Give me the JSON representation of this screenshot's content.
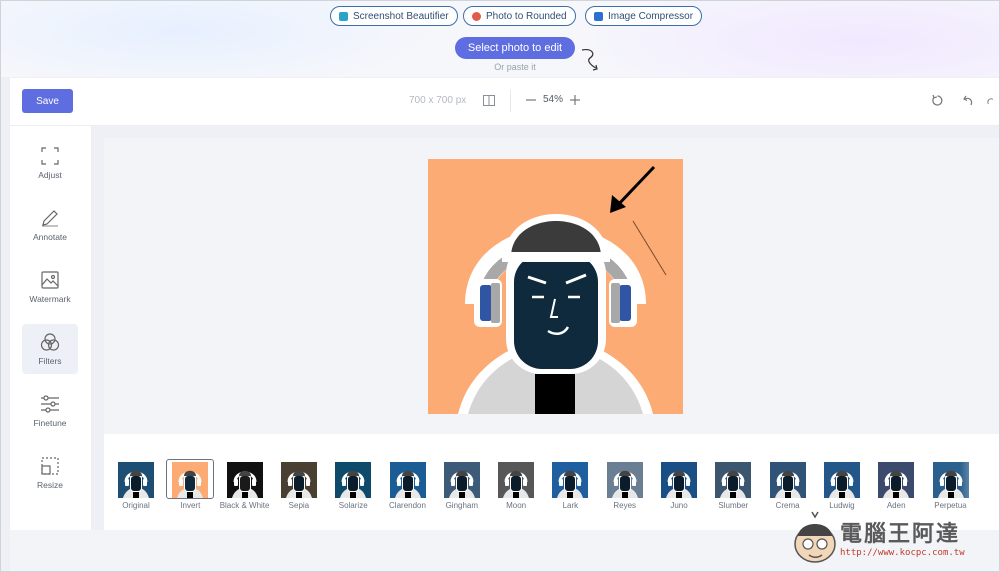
{
  "top_tools": [
    {
      "label": "Screenshot Beautifier",
      "icon": "screenshot-icon",
      "color": "#2aa3c9"
    },
    {
      "label": "Photo to Rounded",
      "icon": "rounded-icon",
      "color": "#e25a4a"
    },
    {
      "label": "Image Compressor",
      "icon": "compress-icon",
      "color": "#2a6fd1"
    }
  ],
  "upload": {
    "button_label": "Select photo to edit",
    "paste_hint": "Or paste it"
  },
  "toolbar": {
    "save_label": "Save",
    "dimensions": "700 x 700 px",
    "zoom": "54%"
  },
  "sidebar": {
    "items": [
      {
        "label": "Adjust",
        "icon": "crop-icon"
      },
      {
        "label": "Annotate",
        "icon": "pencil-icon"
      },
      {
        "label": "Watermark",
        "icon": "image-icon"
      },
      {
        "label": "Filters",
        "icon": "filters-icon",
        "active": true
      },
      {
        "label": "Finetune",
        "icon": "sliders-icon"
      },
      {
        "label": "Resize",
        "icon": "resize-icon"
      }
    ]
  },
  "filters": {
    "selected": "Invert",
    "items": [
      {
        "label": "Original",
        "bg": "#1d4e73"
      },
      {
        "label": "Invert",
        "bg": "#fbab73"
      },
      {
        "label": "Black & White",
        "bg": "#111111"
      },
      {
        "label": "Sepia",
        "bg": "#4a4032"
      },
      {
        "label": "Solarize",
        "bg": "#0e4b6b"
      },
      {
        "label": "Clarendon",
        "bg": "#1a5c93"
      },
      {
        "label": "Gingham",
        "bg": "#3d5a78"
      },
      {
        "label": "Moon",
        "bg": "#575757"
      },
      {
        "label": "Lark",
        "bg": "#1f5fa0"
      },
      {
        "label": "Reyes",
        "bg": "#6a7f94"
      },
      {
        "label": "Juno",
        "bg": "#1a4f86"
      },
      {
        "label": "Slumber",
        "bg": "#3c566f"
      },
      {
        "label": "Crema",
        "bg": "#2f5477"
      },
      {
        "label": "Ludwig",
        "bg": "#245789"
      },
      {
        "label": "Aden",
        "bg": "#3c4a6e"
      },
      {
        "label": "Perpetua",
        "bg": "#2b5f8d"
      }
    ]
  },
  "watermark": {
    "brand": "電腦王阿達",
    "url": "http://www.kocpc.com.tw"
  },
  "colors": {
    "accent": "#5e6ee0",
    "photo_bg": "#fbab73",
    "face": "#0e2a3c"
  }
}
